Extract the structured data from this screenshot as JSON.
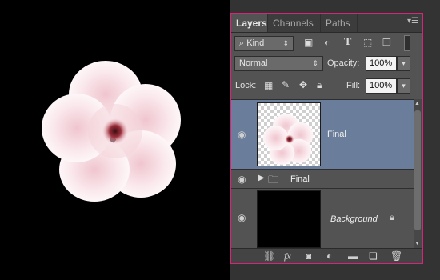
{
  "tabs": [
    "Layers",
    "Channels",
    "Paths"
  ],
  "filter": {
    "label": "Kind"
  },
  "blend": {
    "mode": "Normal",
    "opacity_label": "Opacity:",
    "opacity": "100%"
  },
  "lock": {
    "label": "Lock:",
    "fill_label": "Fill:",
    "fill": "100%"
  },
  "layers": [
    {
      "name": "Final",
      "selected": true
    },
    {
      "name": "Final",
      "type": "group"
    },
    {
      "name": "Background",
      "locked": true
    }
  ],
  "colors": {
    "panel_border": "#d7267a",
    "selected_row": "#6a7d9a",
    "flower_center": "#a8343f"
  }
}
